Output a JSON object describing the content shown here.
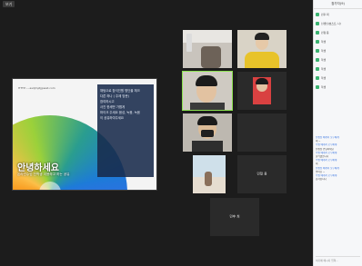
{
  "topbar": {
    "view_label": "보기"
  },
  "slide": {
    "url": "HTTP:....asdjmjdjjpwet.com",
    "panel_lines": [
      "채팅으로 참석인원 명단을 체크",
      "다른 하나 ( 주제 방문)",
      "참여하시고",
      "사진 한세번 가볍게",
      "마이크 주세요 음성, 녹음, 녹음",
      "이 공유하여주세요"
    ],
    "greeting": "안녕하세요",
    "greeting_sub": "온라인수업 전학생 이용하고 하는 공유"
  },
  "gallery": {
    "tiles": [
      {
        "caption": ""
      },
      {
        "caption": ""
      },
      {
        "caption": ""
      },
      {
        "caption": ""
      },
      {
        "caption": ""
      },
      {
        "caption": ""
      },
      {
        "caption": ""
      },
      {
        "name": "민형 용"
      },
      {
        "name": "민후 최"
      }
    ]
  },
  "sidebar": {
    "header": "참가자(9)",
    "participants": [
      "민후 최",
      "선생님(호스트, 나)",
      "민형 용",
      "학생",
      "학생",
      "학생",
      "학생",
      "학생",
      "학생"
    ],
    "chat": {
      "lines": [
        {
          "text": "선생님 에게서 모두에게:",
          "from": true
        },
        {
          "text": "네 ~",
          "from": false
        },
        {
          "text": "학생 에게서 모두에게:",
          "from": true
        },
        {
          "text": "선생님 안녕하세요",
          "from": false
        },
        {
          "text": "학생 에게서 모두에게:",
          "from": true
        },
        {
          "text": "출석했습니다",
          "from": false
        },
        {
          "text": "학생 에게서 모두에게:",
          "from": true
        },
        {
          "text": "네",
          "from": false
        },
        {
          "text": "선생님 에게서 모두에게:",
          "from": true
        },
        {
          "text": "좋아요 ~",
          "from": false
        },
        {
          "text": "학생 에게서 모두에게:",
          "from": true
        },
        {
          "text": "감사합니다",
          "from": false
        }
      ],
      "input_placeholder": "여기에 메시지 입력..."
    }
  },
  "colors": {
    "stage_bg": "#1c1c1c",
    "speaking_outline": "#8be04f",
    "chat_sender": "#2d6cdf"
  }
}
